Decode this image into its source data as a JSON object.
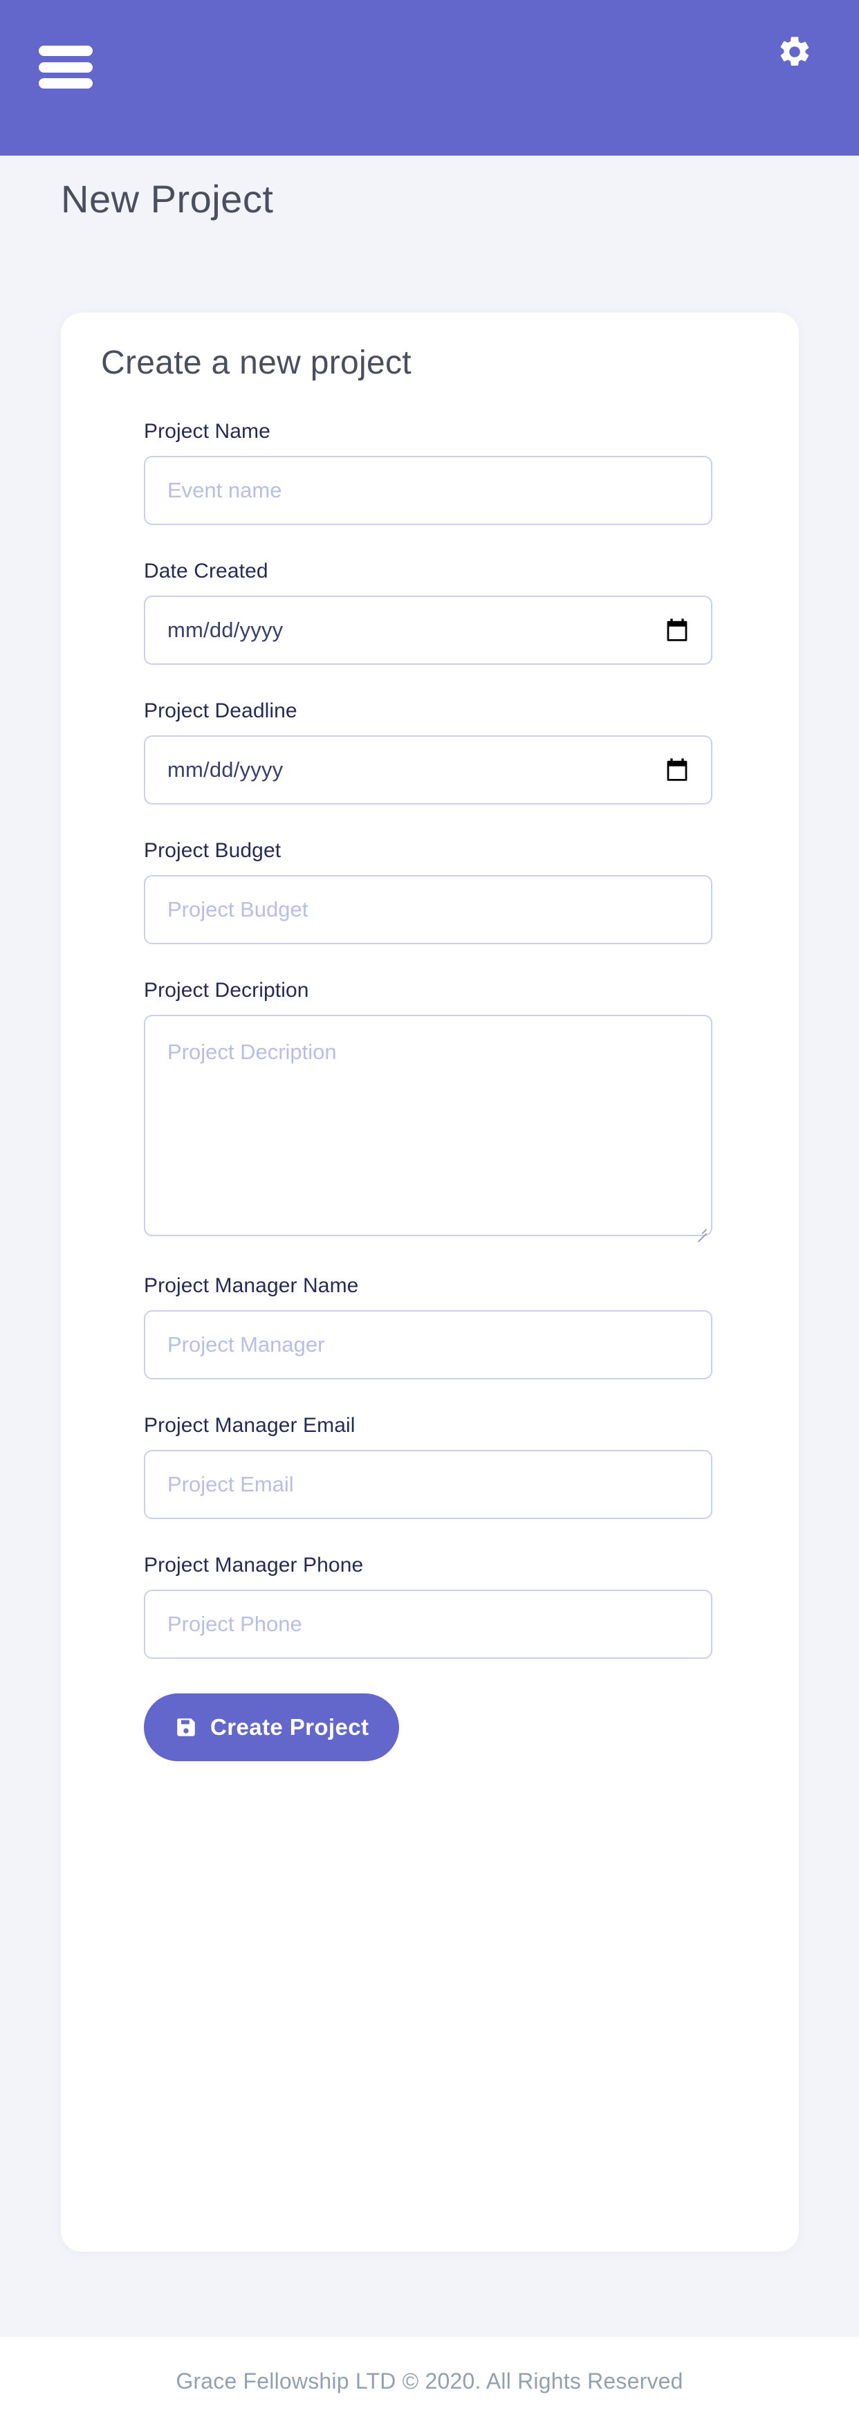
{
  "colors": {
    "brand_purple": "#6366CB",
    "page_bg": "#F3F4F9",
    "card_bg": "#FFFFFF",
    "label_text": "#262B54",
    "title_text": "#4A4E5E",
    "placeholder_text": "#B9BEE6",
    "input_border": "#CBCFEC",
    "footer_text": "#93A1AF"
  },
  "appbar": {
    "menu_icon": "hamburger-menu-icon",
    "settings_icon": "gear-icon"
  },
  "page": {
    "title": "New Project"
  },
  "card": {
    "title": "Create a new project",
    "fields": [
      {
        "id": "project-name",
        "label": "Project Name",
        "type": "text",
        "placeholder": "Event name",
        "value": ""
      },
      {
        "id": "date-created",
        "label": "Date Created",
        "type": "date",
        "placeholder": "mm/dd/yyyy",
        "value": "",
        "icon": "calendar-icon"
      },
      {
        "id": "project-deadline",
        "label": "Project Deadline",
        "type": "date",
        "placeholder": "mm/dd/yyyy",
        "value": "",
        "icon": "calendar-icon"
      },
      {
        "id": "project-budget",
        "label": "Project Budget",
        "type": "text",
        "placeholder": "Project Budget",
        "value": ""
      },
      {
        "id": "project-description",
        "label": "Project Decription",
        "type": "textarea",
        "placeholder": "Project Decription",
        "value": ""
      },
      {
        "id": "project-manager-name",
        "label": "Project Manager Name",
        "type": "text",
        "placeholder": "Project Manager",
        "value": ""
      },
      {
        "id": "project-manager-email",
        "label": "Project Manager Email",
        "type": "text",
        "placeholder": "Project Email",
        "value": ""
      },
      {
        "id": "project-manager-phone",
        "label": "Project Manager Phone",
        "type": "text",
        "placeholder": "Project Phone",
        "value": ""
      }
    ],
    "submit": {
      "label": "Create Project",
      "icon": "save-floppy-icon"
    }
  },
  "footer": {
    "text": "Grace Fellowship LTD © 2020. All Rights Reserved"
  }
}
